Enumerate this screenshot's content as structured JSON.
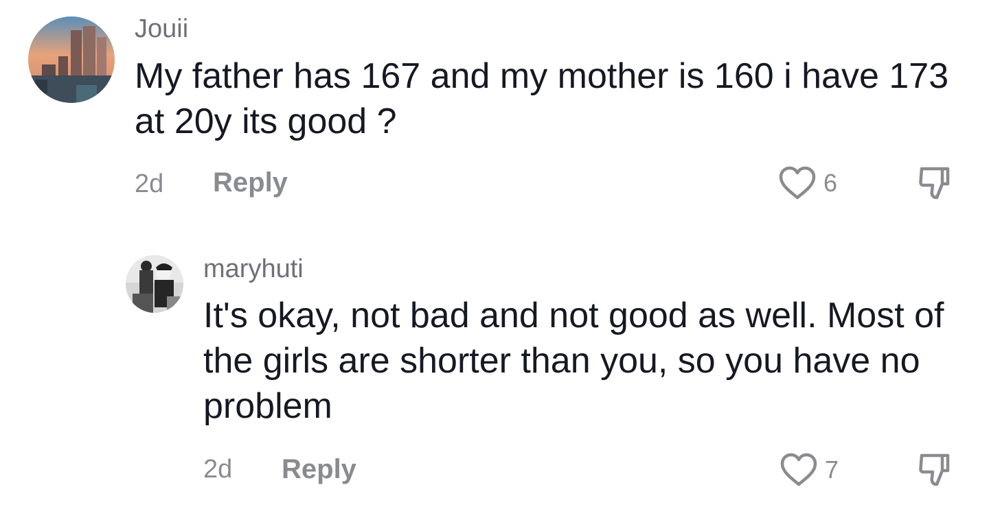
{
  "comments": [
    {
      "username": "Jouii",
      "text": "My father has 167 and my mother is 160 i have 173 at 20y its good ?",
      "time": "2d",
      "reply_label": "Reply",
      "likes": "6",
      "avatar_icon": "city-skyline-avatar"
    },
    {
      "username": "maryhuti",
      "text": "It's okay, not bad and not good as well. Most of the girls are shorter than you, so you have no problem",
      "time": "2d",
      "reply_label": "Reply",
      "likes": "7",
      "avatar_icon": "black-white-photo-avatar"
    }
  ],
  "colors": {
    "text": "#161823",
    "muted": "#8a8b91",
    "username": "#6f7078"
  }
}
